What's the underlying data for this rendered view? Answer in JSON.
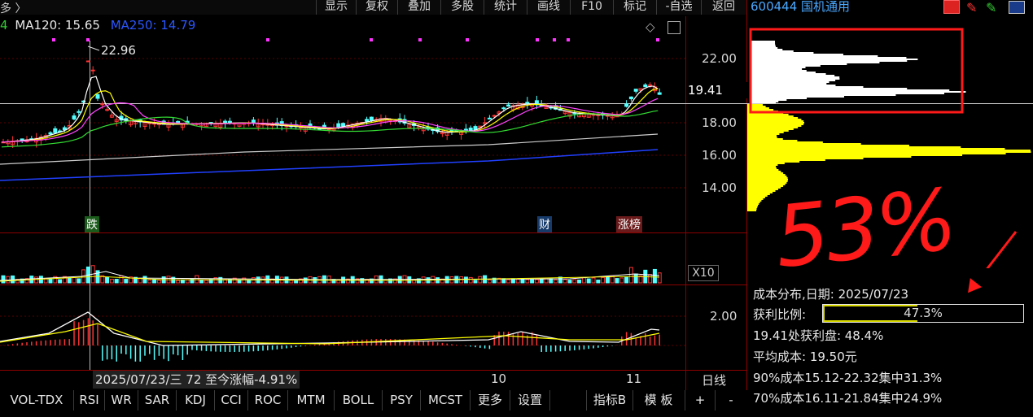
{
  "header": {
    "left_fragment": "多 〉",
    "toolbar": [
      "显示",
      "复权",
      "叠加",
      "多股",
      "统计",
      "画线",
      "F10",
      "标记",
      "-自选",
      "返回"
    ],
    "stock": "600444 国机通用"
  },
  "indicators": {
    "ma_prefix": "4",
    "ma120": "MA120: 15.65",
    "ma250": "MA250: 14.79"
  },
  "chart": {
    "high_label": "22.96",
    "current_price": "19.41",
    "price_ticks": [
      "22.00",
      "18.00",
      "16.00",
      "14.00"
    ],
    "volume_multiplier": "X10",
    "rsi_tick": "2.00",
    "markers": {
      "die": "跌",
      "cai": "财",
      "zhangbang": "涨榜"
    },
    "status_text": "2025/07/23/三 72 至今涨幅-4.91%",
    "month_labels": [
      "10",
      "11"
    ],
    "period": "日线"
  },
  "annotation": {
    "text": "53%"
  },
  "cost_distribution": {
    "date_line": "成本分布,日期:  2025/07/23",
    "profit_label": "获利比例:",
    "profit_value": "47.3%",
    "profit_fraction": 0.473,
    "profit_at_price": "19.41处获利盘:  48.4%",
    "avg_cost": "平均成本:  19.50元",
    "cost90": "90%成本15.12-22.32集中31.3%",
    "cost70": "70%成本16.11-21.84集中24.9%"
  },
  "tabs": [
    "VOL-TDX",
    "RSI",
    "WR",
    "SAR",
    "KDJ",
    "CCI",
    "ROC",
    "MTM",
    "BOLL",
    "PSY",
    "MCST",
    "更多",
    "设置"
  ],
  "right_tabs": [
    "指标B",
    "模 板",
    "+",
    "-"
  ],
  "colors": {
    "up": "#ff3333",
    "down": "#54ffff",
    "ma_blue": "#2040ff",
    "chip": "#ffff00",
    "annotation": "#ff1a1a"
  }
}
